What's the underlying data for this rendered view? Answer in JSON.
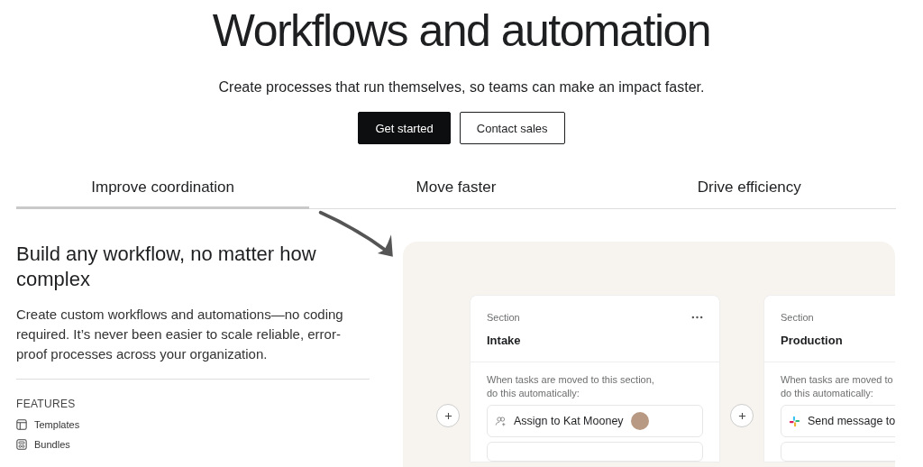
{
  "hero": {
    "title": "Workflows and automation",
    "subtitle": "Create processes that run themselves, so teams can make an impact faster.",
    "buttons": [
      {
        "label": "Get started",
        "kind": "primary"
      },
      {
        "label": "Contact sales",
        "kind": "secondary"
      }
    ]
  },
  "tabs": [
    {
      "label": "Improve coordination",
      "selected": true
    },
    {
      "label": "Move faster",
      "selected": false
    },
    {
      "label": "Drive efficiency",
      "selected": false
    }
  ],
  "feature": {
    "heading": "Build any workflow, no matter how complex",
    "body": "Create custom workflows and automations—no coding required. It’s never been easier to scale reliable, error-proof processes across your organization.",
    "features_label": "FEATURES",
    "features": [
      {
        "label": "Templates",
        "kind": "template"
      },
      {
        "label": "Bundles",
        "kind": "bundle"
      }
    ]
  },
  "board": {
    "sections": [
      {
        "eyebrow": "Section",
        "title": "Intake",
        "trigger_lines": [
          "When tasks are moved to this section,",
          "do this automatically:"
        ],
        "actions": [
          {
            "label": "Assign to Kat Mooney",
            "kind": "assign"
          }
        ]
      },
      {
        "eyebrow": "Section",
        "title": "Production",
        "trigger_lines": [
          "When tasks are moved to",
          "do this automatically:"
        ],
        "actions": [
          {
            "label": "Send message to",
            "kind": "message"
          }
        ]
      }
    ]
  }
}
